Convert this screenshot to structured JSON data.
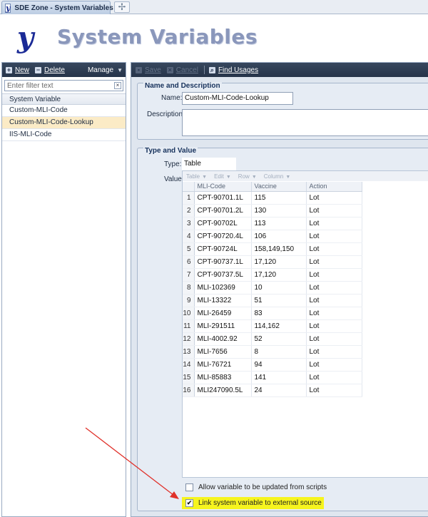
{
  "tab": {
    "title": "SDE Zone - System Variables",
    "icon": "y"
  },
  "header": {
    "logo": "y",
    "title": "System Variables"
  },
  "left_toolbar": {
    "new_label": "New",
    "delete_label": "Delete",
    "manage_label": "Manage"
  },
  "filter": {
    "placeholder": "Enter filter text"
  },
  "list": {
    "header": "System Variable",
    "items": [
      "Custom-MLI-Code",
      "Custom-MLI-Code-Lookup",
      "IIS-MLI-Code"
    ],
    "selected": "Custom-MLI-Code-Lookup"
  },
  "right_toolbar": {
    "save_label": "Save",
    "cancel_label": "Cancel",
    "find_usages_label": "Find Usages"
  },
  "name_description": {
    "title": "Name and Description",
    "name_label": "Name:",
    "name_value": "Custom-MLI-Code-Lookup",
    "description_label": "Description:",
    "description_value": ""
  },
  "type_value": {
    "title": "Type and Value",
    "type_label": "Type:",
    "type_value": "Table",
    "value_label": "Value:",
    "grid_toolbar": [
      "Table",
      "Edit",
      "Row",
      "Column"
    ],
    "columns": [
      "MLI-Code",
      "Vaccine",
      "Action"
    ],
    "rows": [
      [
        "1",
        "CPT-90701.1L",
        "115",
        "Lot"
      ],
      [
        "2",
        "CPT-90701.2L",
        "130",
        "Lot"
      ],
      [
        "3",
        "CPT-90702L",
        "113",
        "Lot"
      ],
      [
        "4",
        "CPT-90720.4L",
        "106",
        "Lot"
      ],
      [
        "5",
        "CPT-90724L",
        "158,149,150",
        "Lot"
      ],
      [
        "6",
        "CPT-90737.1L",
        "17,120",
        "Lot"
      ],
      [
        "7",
        "CPT-90737.5L",
        "17,120",
        "Lot"
      ],
      [
        "8",
        "MLI-102369",
        "10",
        "Lot"
      ],
      [
        "9",
        "MLI-13322",
        "51",
        "Lot"
      ],
      [
        "10",
        "MLI-26459",
        "83",
        "Lot"
      ],
      [
        "11",
        "MLI-291511",
        "114,162",
        "Lot"
      ],
      [
        "12",
        "MLI-4002.92",
        "52",
        "Lot"
      ],
      [
        "13",
        "MLI-7656",
        "8",
        "Lot"
      ],
      [
        "14",
        "MLI-76721",
        "94",
        "Lot"
      ],
      [
        "15",
        "MLI-85883",
        "141",
        "Lot"
      ],
      [
        "16",
        "MLI247090.5L",
        "24",
        "Lot"
      ]
    ]
  },
  "options": {
    "allow_scripts_label": "Allow variable to be updated from scripts",
    "allow_scripts_checked": false,
    "link_external_label": "Link system variable to external source",
    "link_external_checked": true
  },
  "colors": {
    "annotation_arrow": "#e0312a",
    "highlight": "#f6f41e",
    "toolbar": "#2c3a50",
    "selected_row": "#fbebc6"
  }
}
